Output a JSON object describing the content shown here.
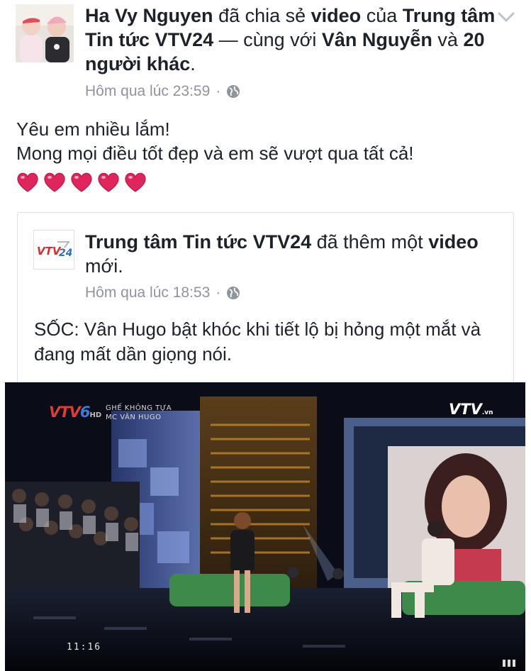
{
  "post": {
    "author": "Ha Vy Nguyen",
    "verb": " đã chia sẻ ",
    "object": "video",
    "of": " của ",
    "page": "Trung tâm Tin tức VTV24",
    "with": " — cùng với ",
    "tagged": "Vân Nguyễn",
    "and": " và ",
    "others": "20 người khác",
    "end": ".",
    "time": "Hôm qua lúc 23:59",
    "sep": "·",
    "text_line1": "Yêu em nhiều lắm!",
    "text_line2": "Mong mọi điều tốt đẹp và em sẽ vượt qua tất cả!",
    "hearts": 5
  },
  "shared": {
    "page": "Trung tâm Tin tức VTV24",
    "verb": " đã thêm một ",
    "object": "video",
    "end": " mới.",
    "time": "Hôm qua lúc 18:53",
    "sep": "·",
    "text": "SỐC: Vân Hugo bật khóc khi tiết lộ bị hỏng một mắt và đang mất dần giọng nói.",
    "logo_text": "VTV24"
  },
  "video": {
    "channel_logo_part1": "VTV",
    "channel_logo_part2": "6",
    "channel_logo_hd": "HD",
    "show_name": "GHẾ KHÔNG TỰA",
    "host": "MC VÂN HUGO",
    "brand": "VTV",
    "brand_suffix": ".vn",
    "timestamp": "11:16"
  },
  "colors": {
    "name": "#1d2129",
    "meta": "#90949c",
    "border": "#dddfe2",
    "heart": "#e0245e"
  }
}
